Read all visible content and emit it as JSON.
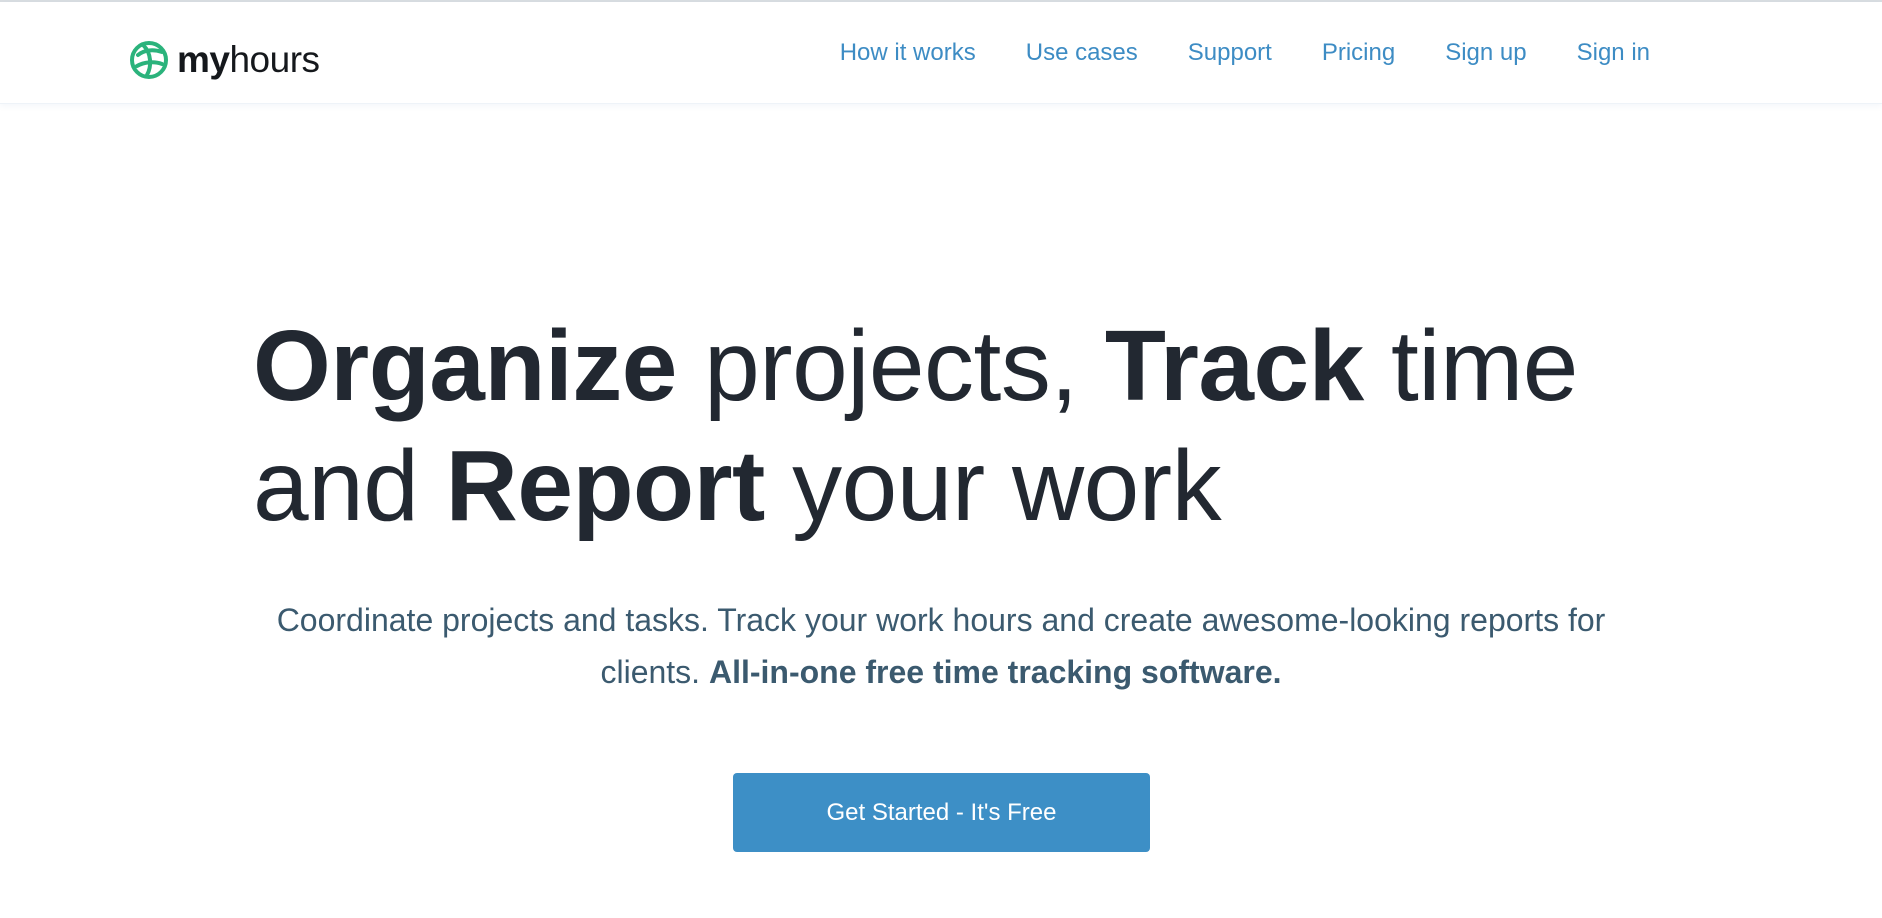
{
  "brand": {
    "name_bold": "my",
    "name_light": "hours",
    "color": "#2bb37c"
  },
  "nav": {
    "items": [
      {
        "label": "How it works"
      },
      {
        "label": "Use cases"
      },
      {
        "label": "Support"
      },
      {
        "label": "Pricing"
      },
      {
        "label": "Sign up"
      },
      {
        "label": "Sign in"
      }
    ],
    "link_color": "#3d8cc4"
  },
  "hero": {
    "headline": {
      "w1": "Organize",
      "t1": " projects, ",
      "w2": "Track",
      "t2": " time and ",
      "w3": "Report",
      "t3": " your work"
    },
    "subtext": {
      "plain": "Coordinate projects and tasks. Track your work hours and create awesome-looking reports for clients. ",
      "bold": "All-in-one free time tracking software."
    },
    "cta_label": "Get Started - It's Free",
    "cta_color": "#3d8fc6"
  }
}
